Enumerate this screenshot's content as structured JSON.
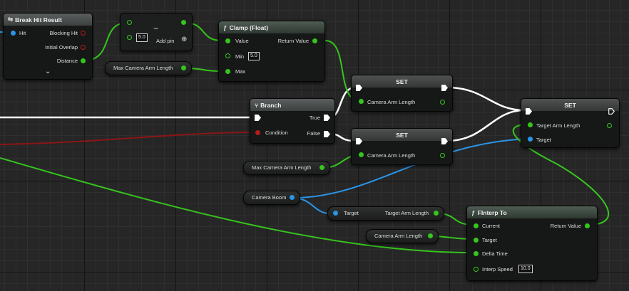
{
  "nodes": {
    "break_hit": {
      "title": "Break Hit Result",
      "pins": {
        "hit": "Hit",
        "blocking": "Blocking Hit",
        "overlap": "Initial Overlap",
        "distance": "Distance"
      },
      "expand_glyph": "⌄"
    },
    "subtract": {
      "title": "−",
      "b_value": "5.0",
      "add_pin": "Add pin"
    },
    "clamp": {
      "title": "Clamp (Float)",
      "fn_glyph": "ƒ",
      "value": "Value",
      "min": "Min",
      "min_value": "5.0",
      "max": "Max",
      "return_value": "Return Value"
    },
    "branch": {
      "title": "Branch",
      "true_label": "True",
      "false_label": "False",
      "condition": "Condition"
    },
    "set_top": {
      "title": "SET",
      "pin": "Camera Arm Length"
    },
    "set_mid": {
      "title": "SET",
      "pin": "Camera Arm Length"
    },
    "set_right": {
      "title": "SET",
      "target_arm": "Target Arm Length",
      "target": "Target"
    },
    "finterp": {
      "title": "FInterp To",
      "fn_glyph": "ƒ",
      "current": "Current",
      "target": "Target",
      "delta_time": "Delta Time",
      "interp_speed": "Interp Speed",
      "interp_value": "10.0",
      "return_value": "Return Value"
    },
    "get_target_arm": {
      "target": "Target",
      "label": "Target Arm Length"
    }
  },
  "getters": {
    "max_arm_top": "Max Camera Arm Length",
    "max_arm_bottom": "Max Camera Arm Length",
    "camera_boom": "Camera Boom",
    "camera_arm_length": "Camera Arm Length"
  },
  "colors": {
    "float_pin": "#35c51d",
    "object_pin": "#2a95e8",
    "bool_pin": "#b51c1c",
    "exec_wire": "#ffffff",
    "background": "#262626"
  }
}
